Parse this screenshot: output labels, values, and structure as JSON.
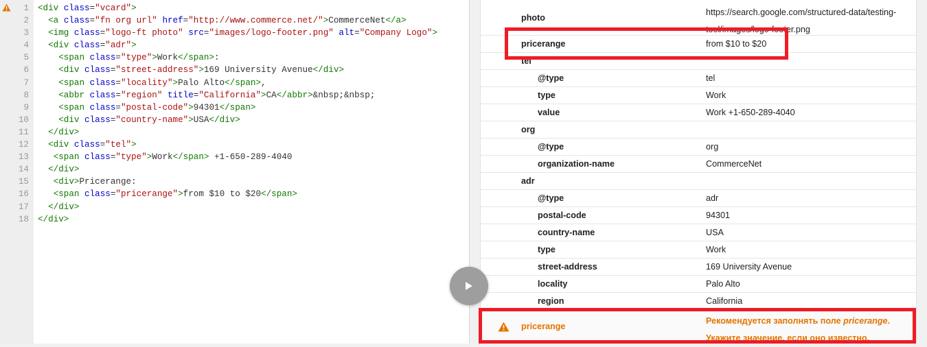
{
  "editor": {
    "lines": [
      {
        "num": "1",
        "parts": [
          {
            "t": "tag",
            "s": "<div"
          },
          {
            "t": "text",
            "s": " "
          },
          {
            "t": "attr",
            "s": "class"
          },
          {
            "t": "text",
            "s": "="
          },
          {
            "t": "str",
            "s": "\"vcard\""
          },
          {
            "t": "tag",
            "s": ">"
          }
        ]
      },
      {
        "num": "2",
        "parts": [
          {
            "t": "text",
            "s": "  "
          },
          {
            "t": "tag",
            "s": "<a"
          },
          {
            "t": "text",
            "s": " "
          },
          {
            "t": "attr",
            "s": "class"
          },
          {
            "t": "text",
            "s": "="
          },
          {
            "t": "str",
            "s": "\"fn org url\""
          },
          {
            "t": "text",
            "s": " "
          },
          {
            "t": "attr",
            "s": "href"
          },
          {
            "t": "text",
            "s": "="
          },
          {
            "t": "str",
            "s": "\"http://www.commerce.net/\""
          },
          {
            "t": "tag",
            "s": ">"
          },
          {
            "t": "text",
            "s": "CommerceNet"
          },
          {
            "t": "tag",
            "s": "</a>"
          }
        ]
      },
      {
        "num": "3",
        "parts": [
          {
            "t": "text",
            "s": "  "
          },
          {
            "t": "tag",
            "s": "<img"
          },
          {
            "t": "text",
            "s": " "
          },
          {
            "t": "attr",
            "s": "class"
          },
          {
            "t": "text",
            "s": "="
          },
          {
            "t": "str",
            "s": "\"logo-ft photo\""
          },
          {
            "t": "text",
            "s": " "
          },
          {
            "t": "attr",
            "s": "src"
          },
          {
            "t": "text",
            "s": "="
          },
          {
            "t": "str",
            "s": "\"images/logo-footer.png\""
          },
          {
            "t": "text",
            "s": " "
          },
          {
            "t": "attr",
            "s": "alt"
          },
          {
            "t": "text",
            "s": "="
          },
          {
            "t": "str",
            "s": "\"Company Logo\""
          },
          {
            "t": "tag",
            "s": ">"
          }
        ]
      },
      {
        "num": "4",
        "parts": [
          {
            "t": "text",
            "s": "  "
          },
          {
            "t": "tag",
            "s": "<div"
          },
          {
            "t": "text",
            "s": " "
          },
          {
            "t": "attr",
            "s": "class"
          },
          {
            "t": "text",
            "s": "="
          },
          {
            "t": "str",
            "s": "\"adr\""
          },
          {
            "t": "tag",
            "s": ">"
          }
        ]
      },
      {
        "num": "5",
        "parts": [
          {
            "t": "text",
            "s": "    "
          },
          {
            "t": "tag",
            "s": "<span"
          },
          {
            "t": "text",
            "s": " "
          },
          {
            "t": "attr",
            "s": "class"
          },
          {
            "t": "text",
            "s": "="
          },
          {
            "t": "str",
            "s": "\"type\""
          },
          {
            "t": "tag",
            "s": ">"
          },
          {
            "t": "text",
            "s": "Work"
          },
          {
            "t": "tag",
            "s": "</span>"
          },
          {
            "t": "text",
            "s": ":"
          }
        ]
      },
      {
        "num": "6",
        "parts": [
          {
            "t": "text",
            "s": "    "
          },
          {
            "t": "tag",
            "s": "<div"
          },
          {
            "t": "text",
            "s": " "
          },
          {
            "t": "attr",
            "s": "class"
          },
          {
            "t": "text",
            "s": "="
          },
          {
            "t": "str",
            "s": "\"street-address\""
          },
          {
            "t": "tag",
            "s": ">"
          },
          {
            "t": "text",
            "s": "169 University Avenue"
          },
          {
            "t": "tag",
            "s": "</div>"
          }
        ]
      },
      {
        "num": "7",
        "parts": [
          {
            "t": "text",
            "s": "    "
          },
          {
            "t": "tag",
            "s": "<span"
          },
          {
            "t": "text",
            "s": " "
          },
          {
            "t": "attr",
            "s": "class"
          },
          {
            "t": "text",
            "s": "="
          },
          {
            "t": "str",
            "s": "\"locality\""
          },
          {
            "t": "tag",
            "s": ">"
          },
          {
            "t": "text",
            "s": "Palo Alto"
          },
          {
            "t": "tag",
            "s": "</span>"
          },
          {
            "t": "text",
            "s": ","
          }
        ]
      },
      {
        "num": "8",
        "parts": [
          {
            "t": "text",
            "s": "    "
          },
          {
            "t": "tag",
            "s": "<abbr"
          },
          {
            "t": "text",
            "s": " "
          },
          {
            "t": "attr",
            "s": "class"
          },
          {
            "t": "text",
            "s": "="
          },
          {
            "t": "str",
            "s": "\"region\""
          },
          {
            "t": "text",
            "s": " "
          },
          {
            "t": "attr",
            "s": "title"
          },
          {
            "t": "text",
            "s": "="
          },
          {
            "t": "str",
            "s": "\"California\""
          },
          {
            "t": "tag",
            "s": ">"
          },
          {
            "t": "text",
            "s": "CA"
          },
          {
            "t": "tag",
            "s": "</abbr>"
          },
          {
            "t": "text",
            "s": "&nbsp;&nbsp;"
          }
        ]
      },
      {
        "num": "9",
        "parts": [
          {
            "t": "text",
            "s": "    "
          },
          {
            "t": "tag",
            "s": "<span"
          },
          {
            "t": "text",
            "s": " "
          },
          {
            "t": "attr",
            "s": "class"
          },
          {
            "t": "text",
            "s": "="
          },
          {
            "t": "str",
            "s": "\"postal-code\""
          },
          {
            "t": "tag",
            "s": ">"
          },
          {
            "t": "text",
            "s": "94301"
          },
          {
            "t": "tag",
            "s": "</span>"
          }
        ]
      },
      {
        "num": "10",
        "parts": [
          {
            "t": "text",
            "s": "    "
          },
          {
            "t": "tag",
            "s": "<div"
          },
          {
            "t": "text",
            "s": " "
          },
          {
            "t": "attr",
            "s": "class"
          },
          {
            "t": "text",
            "s": "="
          },
          {
            "t": "str",
            "s": "\"country-name\""
          },
          {
            "t": "tag",
            "s": ">"
          },
          {
            "t": "text",
            "s": "USA"
          },
          {
            "t": "tag",
            "s": "</div>"
          }
        ]
      },
      {
        "num": "11",
        "parts": [
          {
            "t": "text",
            "s": "  "
          },
          {
            "t": "tag",
            "s": "</div>"
          }
        ]
      },
      {
        "num": "12",
        "parts": [
          {
            "t": "text",
            "s": "  "
          },
          {
            "t": "tag",
            "s": "<div"
          },
          {
            "t": "text",
            "s": " "
          },
          {
            "t": "attr",
            "s": "class"
          },
          {
            "t": "text",
            "s": "="
          },
          {
            "t": "str",
            "s": "\"tel\""
          },
          {
            "t": "tag",
            "s": ">"
          }
        ]
      },
      {
        "num": "13",
        "parts": [
          {
            "t": "text",
            "s": "   "
          },
          {
            "t": "tag",
            "s": "<span"
          },
          {
            "t": "text",
            "s": " "
          },
          {
            "t": "attr",
            "s": "class"
          },
          {
            "t": "text",
            "s": "="
          },
          {
            "t": "str",
            "s": "\"type\""
          },
          {
            "t": "tag",
            "s": ">"
          },
          {
            "t": "text",
            "s": "Work"
          },
          {
            "t": "tag",
            "s": "</span>"
          },
          {
            "t": "text",
            "s": " +1-650-289-4040"
          }
        ]
      },
      {
        "num": "14",
        "parts": [
          {
            "t": "text",
            "s": "  "
          },
          {
            "t": "tag",
            "s": "</div>"
          }
        ]
      },
      {
        "num": "15",
        "parts": [
          {
            "t": "text",
            "s": "   "
          },
          {
            "t": "tag",
            "s": "<div>"
          },
          {
            "t": "text",
            "s": "Pricerange:"
          }
        ]
      },
      {
        "num": "16",
        "parts": [
          {
            "t": "text",
            "s": "   "
          },
          {
            "t": "tag",
            "s": "<span"
          },
          {
            "t": "text",
            "s": " "
          },
          {
            "t": "attr",
            "s": "class"
          },
          {
            "t": "text",
            "s": "="
          },
          {
            "t": "str",
            "s": "\"pricerange\""
          },
          {
            "t": "tag",
            "s": ">"
          },
          {
            "t": "text",
            "s": "from $10 to $20"
          },
          {
            "t": "tag",
            "s": "</span>"
          }
        ]
      },
      {
        "num": "17",
        "parts": [
          {
            "t": "text",
            "s": "  "
          },
          {
            "t": "tag",
            "s": "</div>"
          }
        ]
      },
      {
        "num": "18",
        "parts": [
          {
            "t": "tag",
            "s": "</div>"
          }
        ]
      }
    ]
  },
  "results": {
    "photo": {
      "key": "photo",
      "value": "https://search.google.com/structured-data/testing-tool/images/logo-footer.png"
    },
    "rows": [
      {
        "key": "pricerange",
        "value": "from $10 to $20",
        "level": 1
      },
      {
        "key": "tel",
        "value": "",
        "level": 1
      },
      {
        "key": "@type",
        "value": "tel",
        "level": 2
      },
      {
        "key": "type",
        "value": "Work",
        "level": 2
      },
      {
        "key": "value",
        "value": "Work +1-650-289-4040",
        "level": 2
      },
      {
        "key": "org",
        "value": "",
        "level": 1
      },
      {
        "key": "@type",
        "value": "org",
        "level": 2
      },
      {
        "key": "organization-name",
        "value": "CommerceNet",
        "level": 2
      },
      {
        "key": "adr",
        "value": "",
        "level": 1
      },
      {
        "key": "@type",
        "value": "adr",
        "level": 2
      },
      {
        "key": "postal-code",
        "value": "94301",
        "level": 2
      },
      {
        "key": "country-name",
        "value": "USA",
        "level": 2
      },
      {
        "key": "type",
        "value": "Work",
        "level": 2
      },
      {
        "key": "street-address",
        "value": "169 University Avenue",
        "level": 2
      },
      {
        "key": "locality",
        "value": "Palo Alto",
        "level": 2
      },
      {
        "key": "region",
        "value": "California",
        "level": 2
      }
    ],
    "warning": {
      "key": "pricerange",
      "msg_prefix": "Рекомендуется заполнять поле ",
      "msg_field": "pricerange",
      "msg_suffix": ".",
      "msg_line2": "Укажите значение, если оно известно."
    }
  },
  "icons": {
    "warning": "warning-triangle-icon",
    "play": "play-icon"
  },
  "colors": {
    "warning": "#e37400",
    "highlight": "#ee1c25",
    "tag": "#117700",
    "attr": "#0000cc",
    "string": "#aa1111"
  }
}
